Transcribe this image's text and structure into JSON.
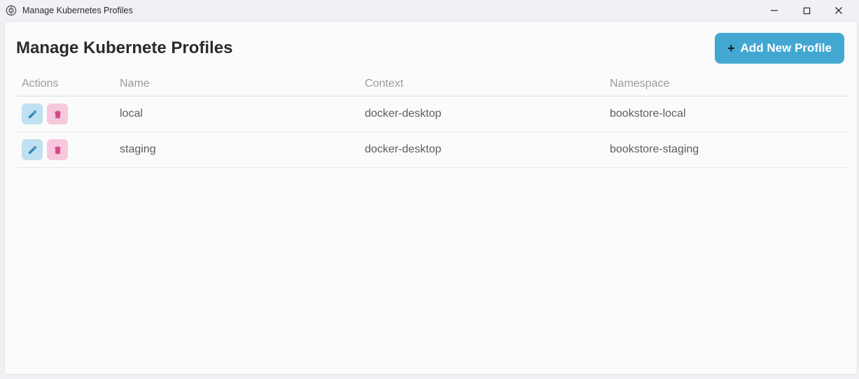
{
  "window": {
    "title": "Manage Kubernetes Profiles"
  },
  "page": {
    "heading": "Manage Kubernete Profiles",
    "add_button_label": "Add New Profile"
  },
  "table": {
    "columns": {
      "actions": "Actions",
      "name": "Name",
      "context": "Context",
      "namespace": "Namespace"
    },
    "rows": [
      {
        "name": "local",
        "context": "docker-desktop",
        "namespace": "bookstore-local"
      },
      {
        "name": "staging",
        "context": "docker-desktop",
        "namespace": "bookstore-staging"
      }
    ]
  },
  "colors": {
    "primary": "#43a8d1",
    "edit_bg": "#bfe1f1",
    "delete_bg": "#f7c8dc",
    "edit_icon": "#2e86b8",
    "delete_icon": "#d4488a"
  }
}
